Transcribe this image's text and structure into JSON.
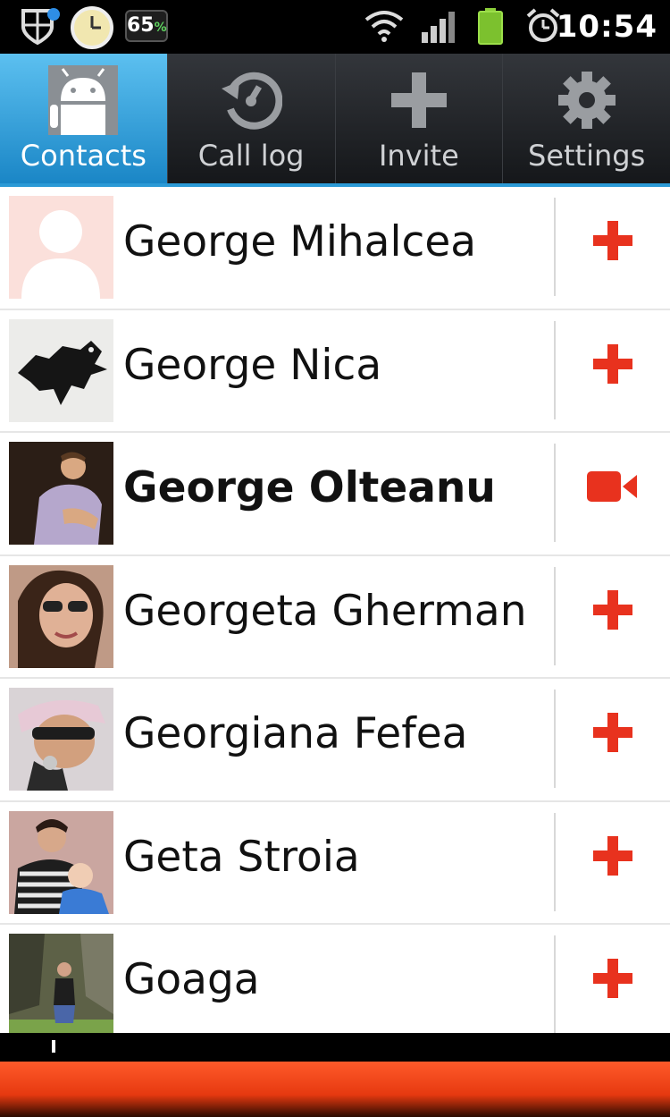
{
  "status_bar": {
    "battery_value": "65",
    "battery_unit": "%",
    "time": "10:54"
  },
  "tabs": [
    {
      "label": "Contacts",
      "icon": "android-icon",
      "active": true
    },
    {
      "label": "Call log",
      "icon": "call-log-icon",
      "active": false
    },
    {
      "label": "Invite",
      "icon": "plus-icon",
      "active": false
    },
    {
      "label": "Settings",
      "icon": "gear-icon",
      "active": false
    }
  ],
  "contacts": [
    {
      "name": "George Mihalcea",
      "action": "add-icon",
      "bold": false,
      "avatar": "placeholder-silhouette"
    },
    {
      "name": "George Nica",
      "action": "add-icon",
      "bold": false,
      "avatar": "wolf-sigil"
    },
    {
      "name": "George Olteanu",
      "action": "video-camera-icon",
      "bold": true,
      "avatar": "photo"
    },
    {
      "name": "Georgeta Gherman",
      "action": "add-icon",
      "bold": false,
      "avatar": "photo"
    },
    {
      "name": "Georgiana Fefea",
      "action": "add-icon",
      "bold": false,
      "avatar": "photo"
    },
    {
      "name": "Geta Stroia",
      "action": "add-icon",
      "bold": false,
      "avatar": "photo"
    },
    {
      "name": "Goaga",
      "action": "add-icon",
      "bold": false,
      "avatar": "photo"
    }
  ],
  "colors": {
    "accent_blue": "#2b9ad6",
    "action_red": "#e8321e",
    "banner_orange": "#ff5a2a"
  }
}
